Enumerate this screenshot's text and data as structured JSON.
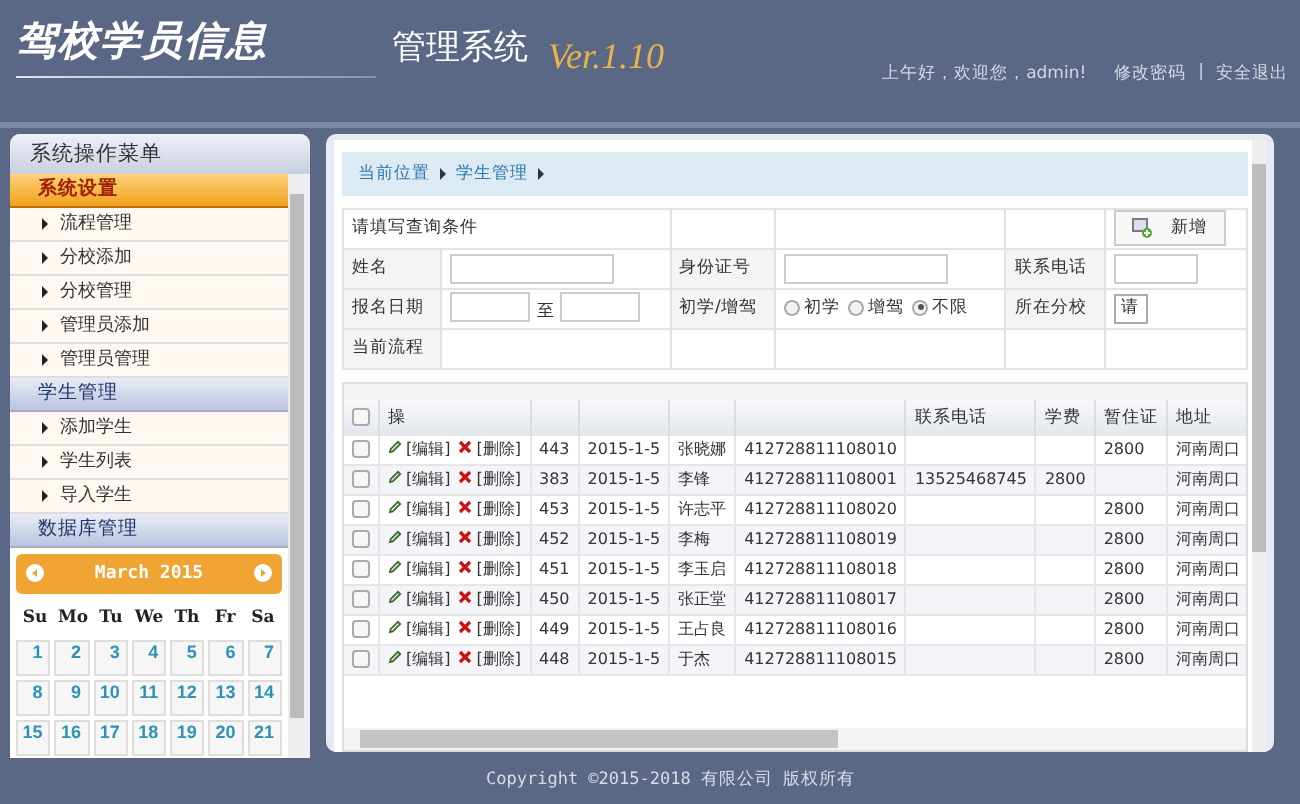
{
  "header": {
    "logo": "驾校学员信息",
    "subtitle": "管理系统",
    "version": "Ver.1.10",
    "greeting": "上午好，欢迎您，admin!",
    "links": [
      "修改密码",
      "安全退出"
    ],
    "separator": "|"
  },
  "sidebar": {
    "title": "系统操作菜单",
    "sections": [
      {
        "title": "系统设置",
        "selected": true,
        "items": [
          "流程管理",
          "分校添加",
          "分校管理",
          "管理员添加",
          "管理员管理"
        ]
      },
      {
        "title": "学生管理",
        "selected": false,
        "items": [
          "添加学生",
          "学生列表",
          "导入学生"
        ]
      },
      {
        "title": "数据库管理",
        "selected": false
      }
    ]
  },
  "calendar": {
    "month": "March 2015",
    "weekdays": [
      "Su",
      "Mo",
      "Tu",
      "We",
      "Th",
      "Fr",
      "Sa"
    ],
    "days": [
      "1",
      "2",
      "3",
      "4",
      "5",
      "6",
      "7",
      "8",
      "9",
      "10",
      "11",
      "12",
      "13",
      "14",
      "15",
      "16",
      "17",
      "18",
      "19",
      "20",
      "21"
    ]
  },
  "breadcrumb": [
    "当前位置",
    "学生管理"
  ],
  "search_form": {
    "title": "请填写查询条件",
    "add_button": "新增",
    "rows": [
      [
        {
          "kind": "label",
          "text": "姓名"
        },
        {
          "kind": "input"
        },
        {
          "kind": "label",
          "text": "身份证号"
        },
        {
          "kind": "input"
        },
        {
          "kind": "label",
          "text": "联系电话"
        },
        {
          "kind": "input"
        }
      ],
      [
        {
          "kind": "label",
          "text": "报名日期"
        },
        {
          "kind": "range",
          "separator": "至"
        },
        {
          "kind": "label",
          "text": "初学/增驾"
        },
        {
          "kind": "radios",
          "options": [
            {
              "label": "初学",
              "selected": false
            },
            {
              "label": "增驾",
              "selected": false
            },
            {
              "label": "不限",
              "selected": true
            }
          ]
        },
        {
          "kind": "label",
          "text": "所在分校"
        },
        {
          "kind": "select",
          "value": "请"
        }
      ],
      [
        {
          "kind": "label",
          "text": "当前流程"
        },
        {
          "kind": "empty"
        },
        {
          "kind": "empty"
        },
        {
          "kind": "empty"
        },
        {
          "kind": "empty"
        },
        {
          "kind": "empty"
        }
      ]
    ]
  },
  "table": {
    "columns": [
      {
        "kind": "checkbox",
        "checked": false
      },
      {
        "kind": "text",
        "label": "操"
      },
      {
        "kind": "blank"
      },
      {
        "kind": "blank"
      },
      {
        "kind": "blank"
      },
      {
        "kind": "blank"
      },
      {
        "kind": "text",
        "label": "联系电话"
      },
      {
        "kind": "text",
        "label": "学费"
      },
      {
        "kind": "text",
        "label": "暂住证"
      },
      {
        "kind": "text",
        "label": "地址"
      }
    ],
    "rows": [
      {
        "checked": false,
        "edit": "[编辑]",
        "delete": "[删除]",
        "id": "443",
        "date": "2015-1-5",
        "name": "张晓娜",
        "id_number": "412728811108010",
        "permit": "2800",
        "address": "河南周口"
      },
      {
        "checked": false,
        "edit": "[编辑]",
        "delete": "[删除]",
        "id": "383",
        "date": "2015-1-5",
        "name": "李锋",
        "id_number": "412728811108001",
        "phone": "13525468745",
        "fee": "2800",
        "address": "河南周口"
      },
      {
        "checked": false,
        "edit": "[编辑]",
        "delete": "[删除]",
        "id": "453",
        "date": "2015-1-5",
        "name": "许志平",
        "id_number": "412728811108020",
        "permit": "2800",
        "address": "河南周口"
      },
      {
        "checked": false,
        "edit": "[编辑]",
        "delete": "[删除]",
        "id": "452",
        "date": "2015-1-5",
        "name": "李梅",
        "id_number": "412728811108019",
        "permit": "2800",
        "address": "河南周口"
      },
      {
        "checked": false,
        "edit": "[编辑]",
        "delete": "[删除]",
        "id": "451",
        "date": "2015-1-5",
        "name": "李玉启",
        "id_number": "412728811108018",
        "permit": "2800",
        "address": "河南周口"
      },
      {
        "checked": false,
        "edit": "[编辑]",
        "delete": "[删除]",
        "id": "450",
        "date": "2015-1-5",
        "name": "张正堂",
        "id_number": "412728811108017",
        "permit": "2800",
        "address": "河南周口"
      },
      {
        "checked": false,
        "edit": "[编辑]",
        "delete": "[删除]",
        "id": "449",
        "date": "2015-1-5",
        "name": "王占良",
        "id_number": "412728811108016",
        "permit": "2800",
        "address": "河南周口"
      },
      {
        "checked": false,
        "edit": "[编辑]",
        "delete": "[删除]",
        "id": "448",
        "date": "2015-1-5",
        "name": "于杰",
        "id_number": "412728811108015",
        "permit": "2800",
        "address": "河南周口"
      }
    ]
  },
  "footer": "Copyright ©2015-2018 有限公司 版权所有"
}
